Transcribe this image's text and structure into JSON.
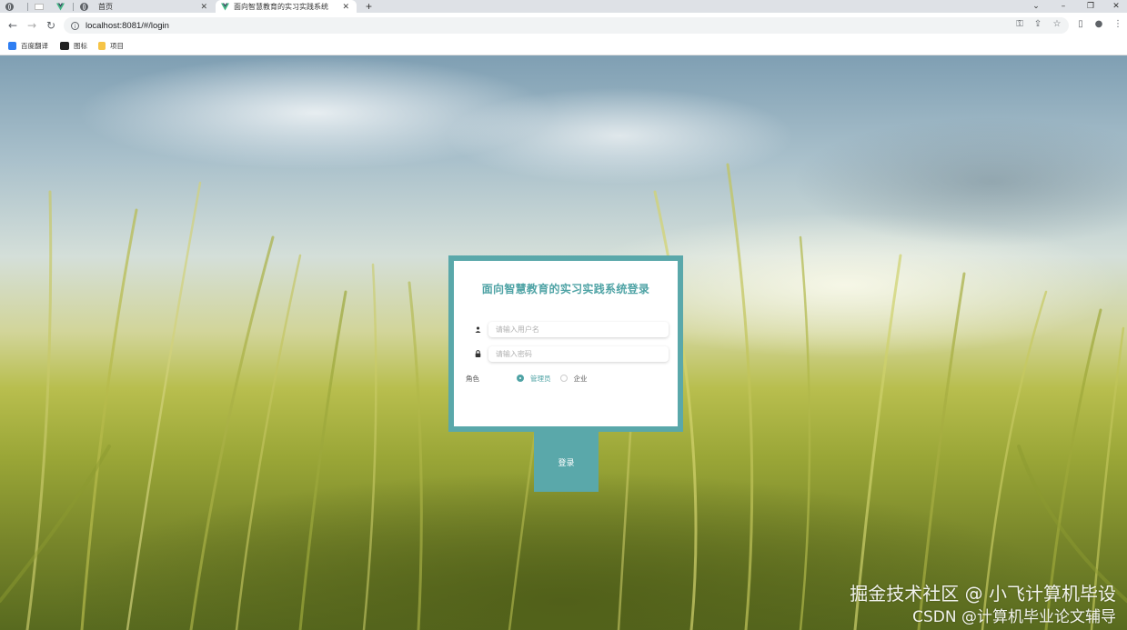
{
  "browser": {
    "tabs": [
      {
        "label": "",
        "icon": "globe-icon"
      },
      {
        "label": "",
        "icon": "blank-page-icon"
      },
      {
        "label": "",
        "icon": "vue-logo-icon"
      },
      {
        "label": "首页",
        "icon": "globe-icon"
      },
      {
        "label": "面向智慧教育的实习实践系统",
        "icon": "vue-logo-icon",
        "active": true
      }
    ],
    "new_tab": "+",
    "window_controls": {
      "dropdown": "⌄",
      "minimize": "–",
      "restore": "❐",
      "close": "✕"
    },
    "url": "localhost:8081/#/login",
    "bookmarks": [
      {
        "label": "百度翻译",
        "icon": "baidu-translate-icon",
        "color": "#2f7ef2"
      },
      {
        "label": "图标",
        "icon": "film-icon",
        "color": "#222222"
      },
      {
        "label": "项目",
        "icon": "folder-icon",
        "color": "#f6c446"
      }
    ]
  },
  "login": {
    "title": "面向智慧教育的实习实践系统登录",
    "username_placeholder": "请输入用户名",
    "password_placeholder": "请输入密码",
    "role_label": "角色",
    "roles": [
      {
        "label": "管理员",
        "selected": true
      },
      {
        "label": "企业",
        "selected": false
      }
    ],
    "submit_label": "登录",
    "accent_color": "#5aa8aa"
  },
  "watermark": {
    "line1": "掘金技术社区 @ 小飞计算机毕设",
    "line2": "CSDN @计算机毕业论文辅导"
  }
}
